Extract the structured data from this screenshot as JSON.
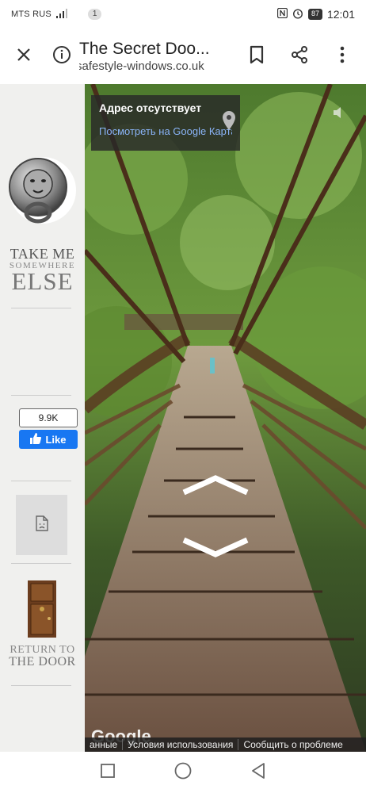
{
  "status_bar": {
    "carrier": "MTS RUS",
    "notification_count": "1",
    "battery": "87",
    "time": "12:01"
  },
  "toolbar": {
    "title": "The Secret Doo...",
    "url": "safestyle-windows.co.uk"
  },
  "sidebar": {
    "take_me_line1": "TAKE ME",
    "take_me_line2": "SOMEWHERE",
    "take_me_line3": "ELSE",
    "like_count": "9.9K",
    "like_label": "Like",
    "return_line1": "RETURN TO",
    "return_line2": "THE DOOR"
  },
  "panorama": {
    "address_title": "Адрес отсутствует",
    "maps_link": "Посмотреть на Google Картах",
    "google_logo": "Google",
    "footer": {
      "data": "анные",
      "terms": "Условия использования",
      "report": "Сообщить о проблеме"
    }
  },
  "colors": {
    "like_blue": "#1877f2",
    "link_blue": "#8ab4f8"
  }
}
